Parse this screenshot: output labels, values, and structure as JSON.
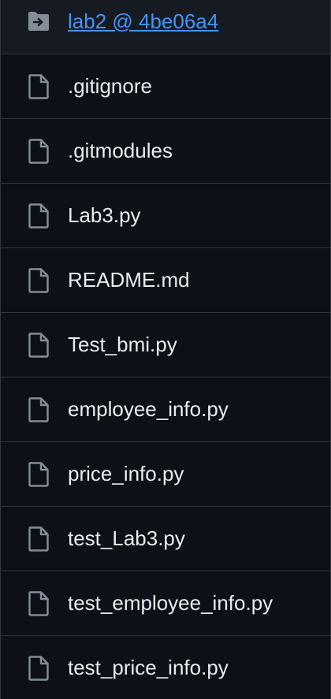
{
  "submodule": {
    "label": "lab2 @ 4be06a4",
    "icon": "submodule-folder-icon"
  },
  "files": [
    {
      "name": ".gitignore",
      "icon": "file-icon"
    },
    {
      "name": ".gitmodules",
      "icon": "file-icon"
    },
    {
      "name": "Lab3.py",
      "icon": "file-icon"
    },
    {
      "name": "README.md",
      "icon": "file-icon"
    },
    {
      "name": "Test_bmi.py",
      "icon": "file-icon"
    },
    {
      "name": "employee_info.py",
      "icon": "file-icon"
    },
    {
      "name": "price_info.py",
      "icon": "file-icon"
    },
    {
      "name": "test_Lab3.py",
      "icon": "file-icon"
    },
    {
      "name": "test_employee_info.py",
      "icon": "file-icon"
    },
    {
      "name": "test_price_info.py",
      "icon": "file-icon"
    }
  ],
  "colors": {
    "background": "#0d1117",
    "border": "#30363d",
    "text": "#e6edf3",
    "link": "#4493f8",
    "icon": "#848d97"
  }
}
